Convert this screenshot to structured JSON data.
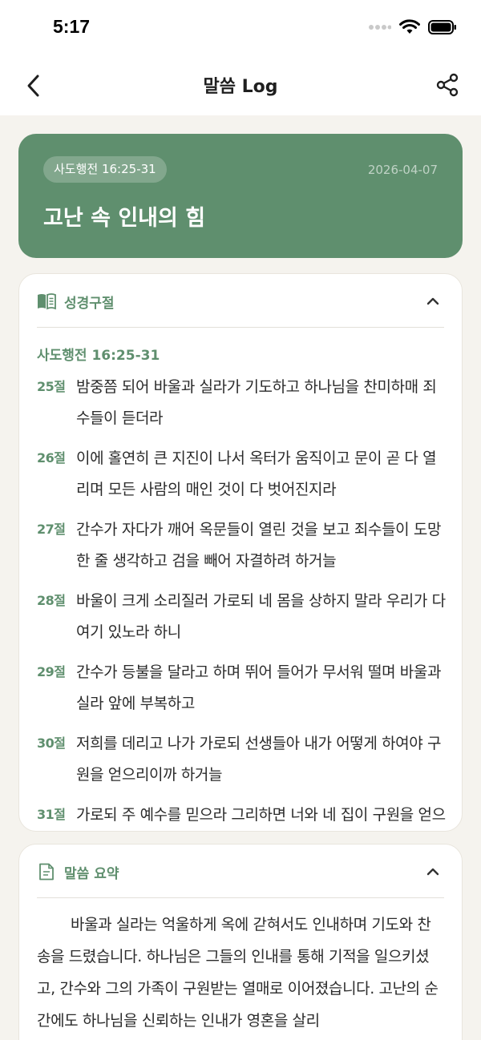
{
  "status": {
    "time": "5:17"
  },
  "nav": {
    "title": "말씀 Log",
    "back_icon": "chevron-left-icon",
    "share_icon": "share-icon"
  },
  "hero": {
    "reference": "사도행전 16:25-31",
    "date": "2026-04-07",
    "title": "고난 속 인내의 힘",
    "bg_color": "#5f8f6e"
  },
  "scripture": {
    "section_title": "성경구절",
    "icon": "book-open-icon",
    "reference": "사도행전 16:25-31",
    "verses": [
      {
        "num": "25절",
        "text": "밤중쯤 되어 바울과 실라가 기도하고 하나님을 찬미하매 죄수들이 듣더라"
      },
      {
        "num": "26절",
        "text": "이에 홀연히 큰 지진이 나서 옥터가 움직이고 문이 곧 다 열리며 모든 사람의 매인 것이 다 벗어진지라"
      },
      {
        "num": "27절",
        "text": "간수가 자다가 깨어 옥문들이 열린 것을 보고 죄수들이 도망한 줄 생각하고 검을 빼어 자결하려 하거늘"
      },
      {
        "num": "28절",
        "text": "바울이 크게 소리질러 가로되 네 몸을 상하지 말라 우리가 다 여기 있노라 하니"
      },
      {
        "num": "29절",
        "text": "간수가 등불을 달라고 하며 뛰어 들어가 무서워 떨며 바울과 실라 앞에 부복하고"
      },
      {
        "num": "30절",
        "text": "저희를 데리고 나가 가로되 선생들아 내가 어떻게 하여야 구원을 얻으리이까 하거늘"
      },
      {
        "num": "31절",
        "text": "가로되 주 예수를 믿으라 그리하면 너와 네 집이 구원을 얻으리라 하고"
      }
    ]
  },
  "summary": {
    "section_title": "말씀 요약",
    "icon": "document-icon",
    "text": "바울과 실라는 억울하게 옥에 갇혀서도 인내하며 기도와 찬송을 드렸습니다. 하나님은 그들의 인내를 통해 기적을 일으키셨고, 간수와 그의 가족이 구원받는 열매로 이어졌습니다. 고난의 순간에도 하나님을 신뢰하는 인내가 영혼을 살리"
  },
  "colors": {
    "accent": "#5f8f6e",
    "background": "#f5f3ee"
  }
}
